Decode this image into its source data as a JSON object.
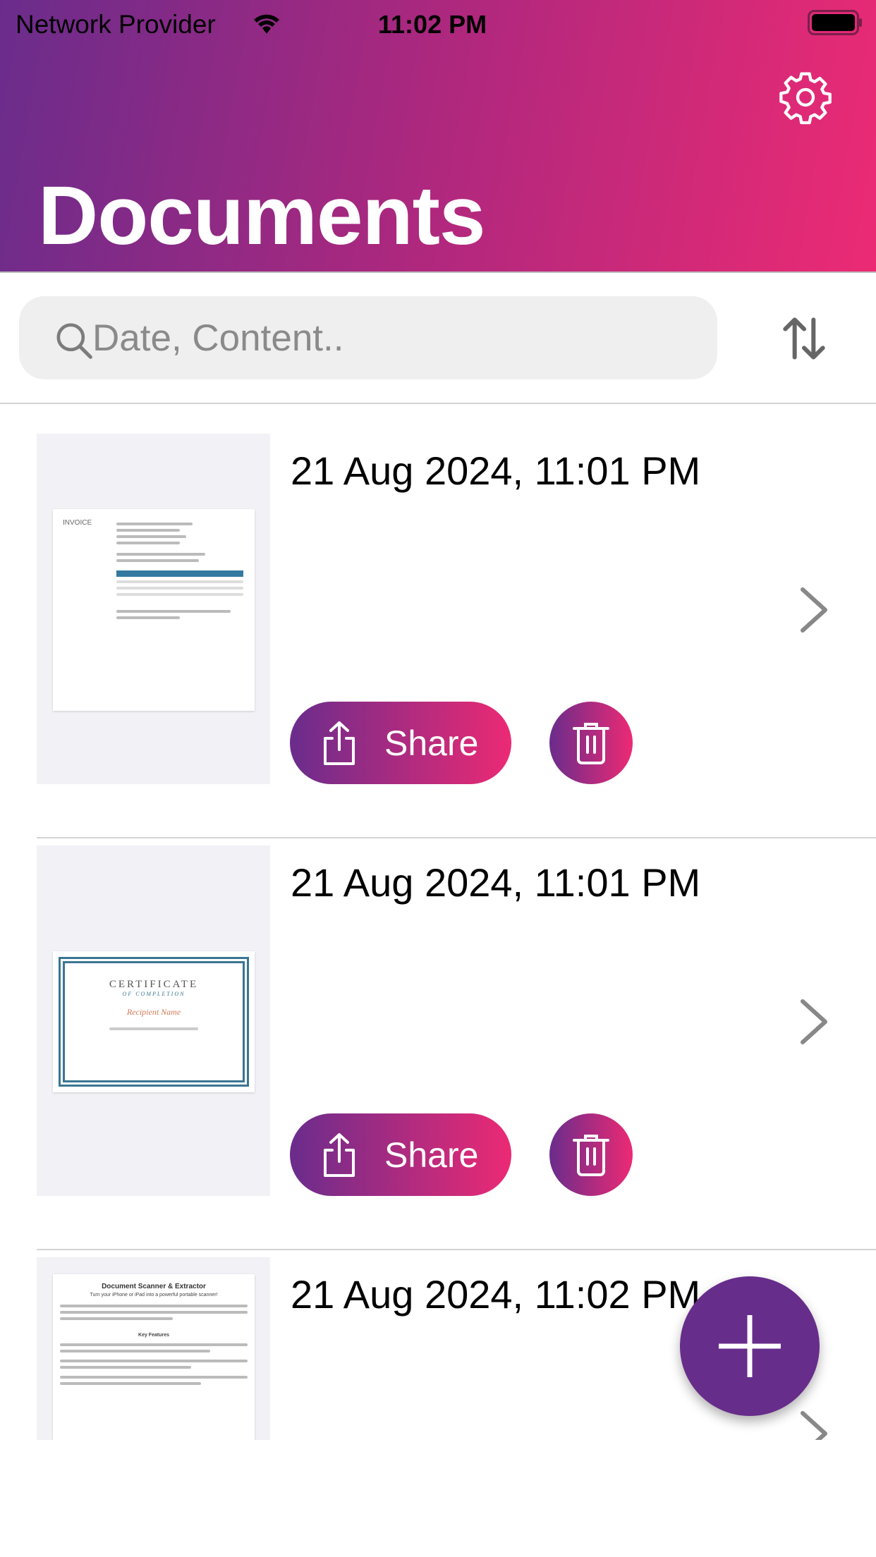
{
  "status_bar": {
    "carrier": "Network Provider",
    "time": "11:02 PM"
  },
  "header": {
    "title": "Documents",
    "gradient": [
      "#6a2c8c",
      "#ec2a74"
    ]
  },
  "search": {
    "placeholder": "Date, Content.."
  },
  "documents": [
    {
      "date": "21 Aug 2024, 11:01 PM",
      "thumbnail": "invoice",
      "share_label": "Share"
    },
    {
      "date": "21 Aug 2024, 11:01 PM",
      "thumbnail": "certificate",
      "share_label": "Share",
      "cert_title": "CERTIFICATE",
      "cert_sub": "OF COMPLETION",
      "cert_name": "Recipient Name"
    },
    {
      "date": "21 Aug 2024, 11:02 PM",
      "thumbnail": "document",
      "doc_title": "Document Scanner & Extractor",
      "doc_sub": "Turn your iPhone or iPad into a powerful portable scanner!",
      "doc_heading": "Key Features"
    }
  ],
  "invoice_thumb": {
    "title": "INVOICE"
  },
  "fab": {
    "icon": "plus-icon",
    "color": "#672d8b"
  }
}
